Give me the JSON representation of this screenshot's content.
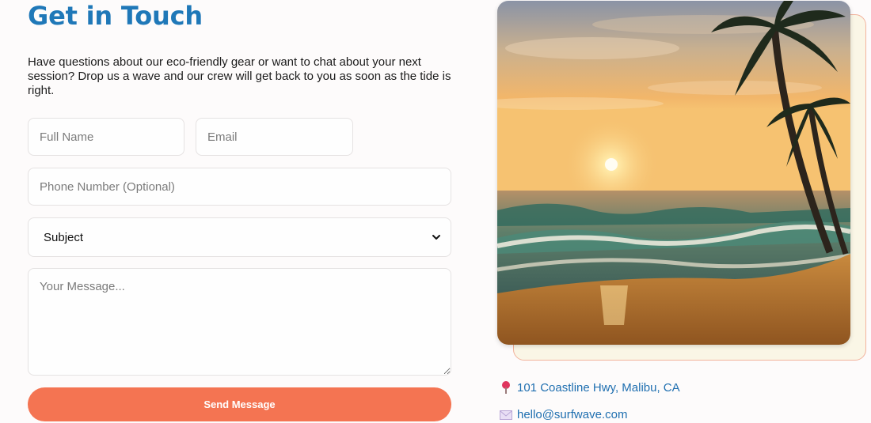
{
  "contact": {
    "title": "Get in Touch",
    "intro": "Have questions about our eco-friendly gear or want to chat about your next session? Drop us a wave and our crew will get back to you as soon as the tide is right."
  },
  "form": {
    "full_name_placeholder": "Full Name",
    "email_placeholder": "Email",
    "phone_placeholder": "Phone Number (Optional)",
    "subject_selected": "Subject",
    "message_placeholder": "Your Message...",
    "send_label": "Send Message"
  },
  "info": {
    "address": "101 Coastline Hwy, Malibu, CA",
    "email": "hello@surfwave.com",
    "address_icon": "map-pin-icon",
    "email_icon": "envelope-icon"
  },
  "colors": {
    "title": "#1f78b8",
    "button": "#f47452",
    "link": "#1f6fb0",
    "image_frame": "#faf6e6"
  }
}
